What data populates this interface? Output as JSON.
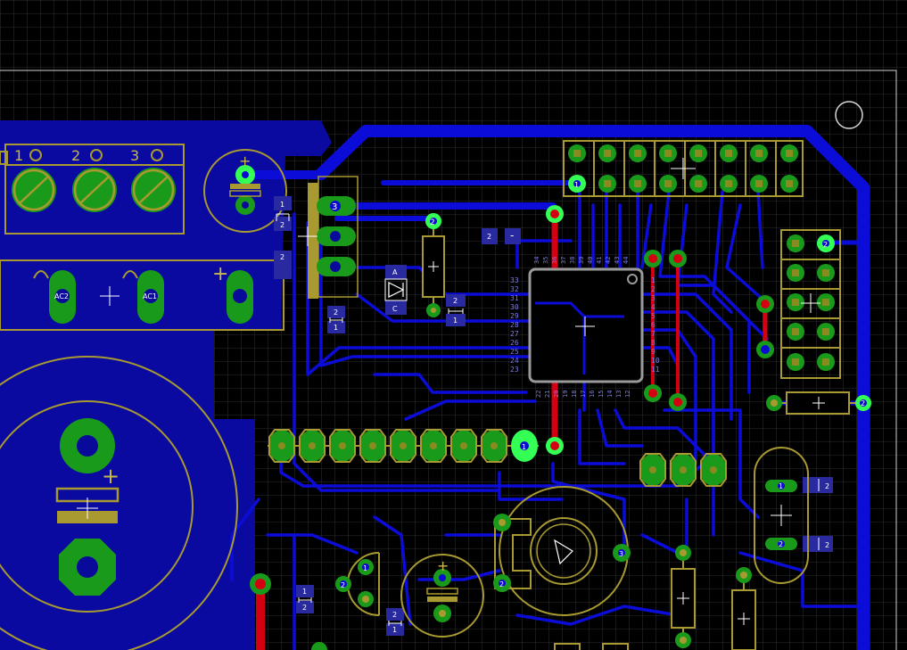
{
  "board": {
    "colors": {
      "background": "#000000",
      "grid": "#3a3a3a",
      "outline": "#c8c8c8",
      "copper_bottom": "#0a0ad0",
      "copper_fill": "#0a0a9a",
      "copper_top": "#d00010",
      "pad": "#1a9a1a",
      "pad_highlight": "#33ff55",
      "silkscreen": "#a89a30",
      "marker": "#ffffff"
    }
  },
  "labels": {
    "terminal_1": "1",
    "terminal_2": "2",
    "terminal_3": "3",
    "ac2": "AC2",
    "ac1": "AC1",
    "plus": "+",
    "minus": "-",
    "anode": "A",
    "cathode": "C",
    "one": "1",
    "two": "2",
    "three": "3",
    "ic_left_pins": [
      "33",
      "32",
      "31",
      "30",
      "29",
      "28",
      "27",
      "26",
      "25",
      "24",
      "23"
    ],
    "ic_top_pins": [
      "34",
      "35",
      "36",
      "37",
      "38",
      "39",
      "40",
      "41",
      "42",
      "43",
      "44"
    ],
    "ic_right_pins": [
      "1",
      "2",
      "3",
      "4",
      "5",
      "6",
      "7",
      "8",
      "9",
      "10",
      "11"
    ],
    "ic_bottom_pins": [
      "22",
      "21",
      "20",
      "19",
      "18",
      "17",
      "16",
      "15",
      "14",
      "13",
      "12"
    ]
  }
}
